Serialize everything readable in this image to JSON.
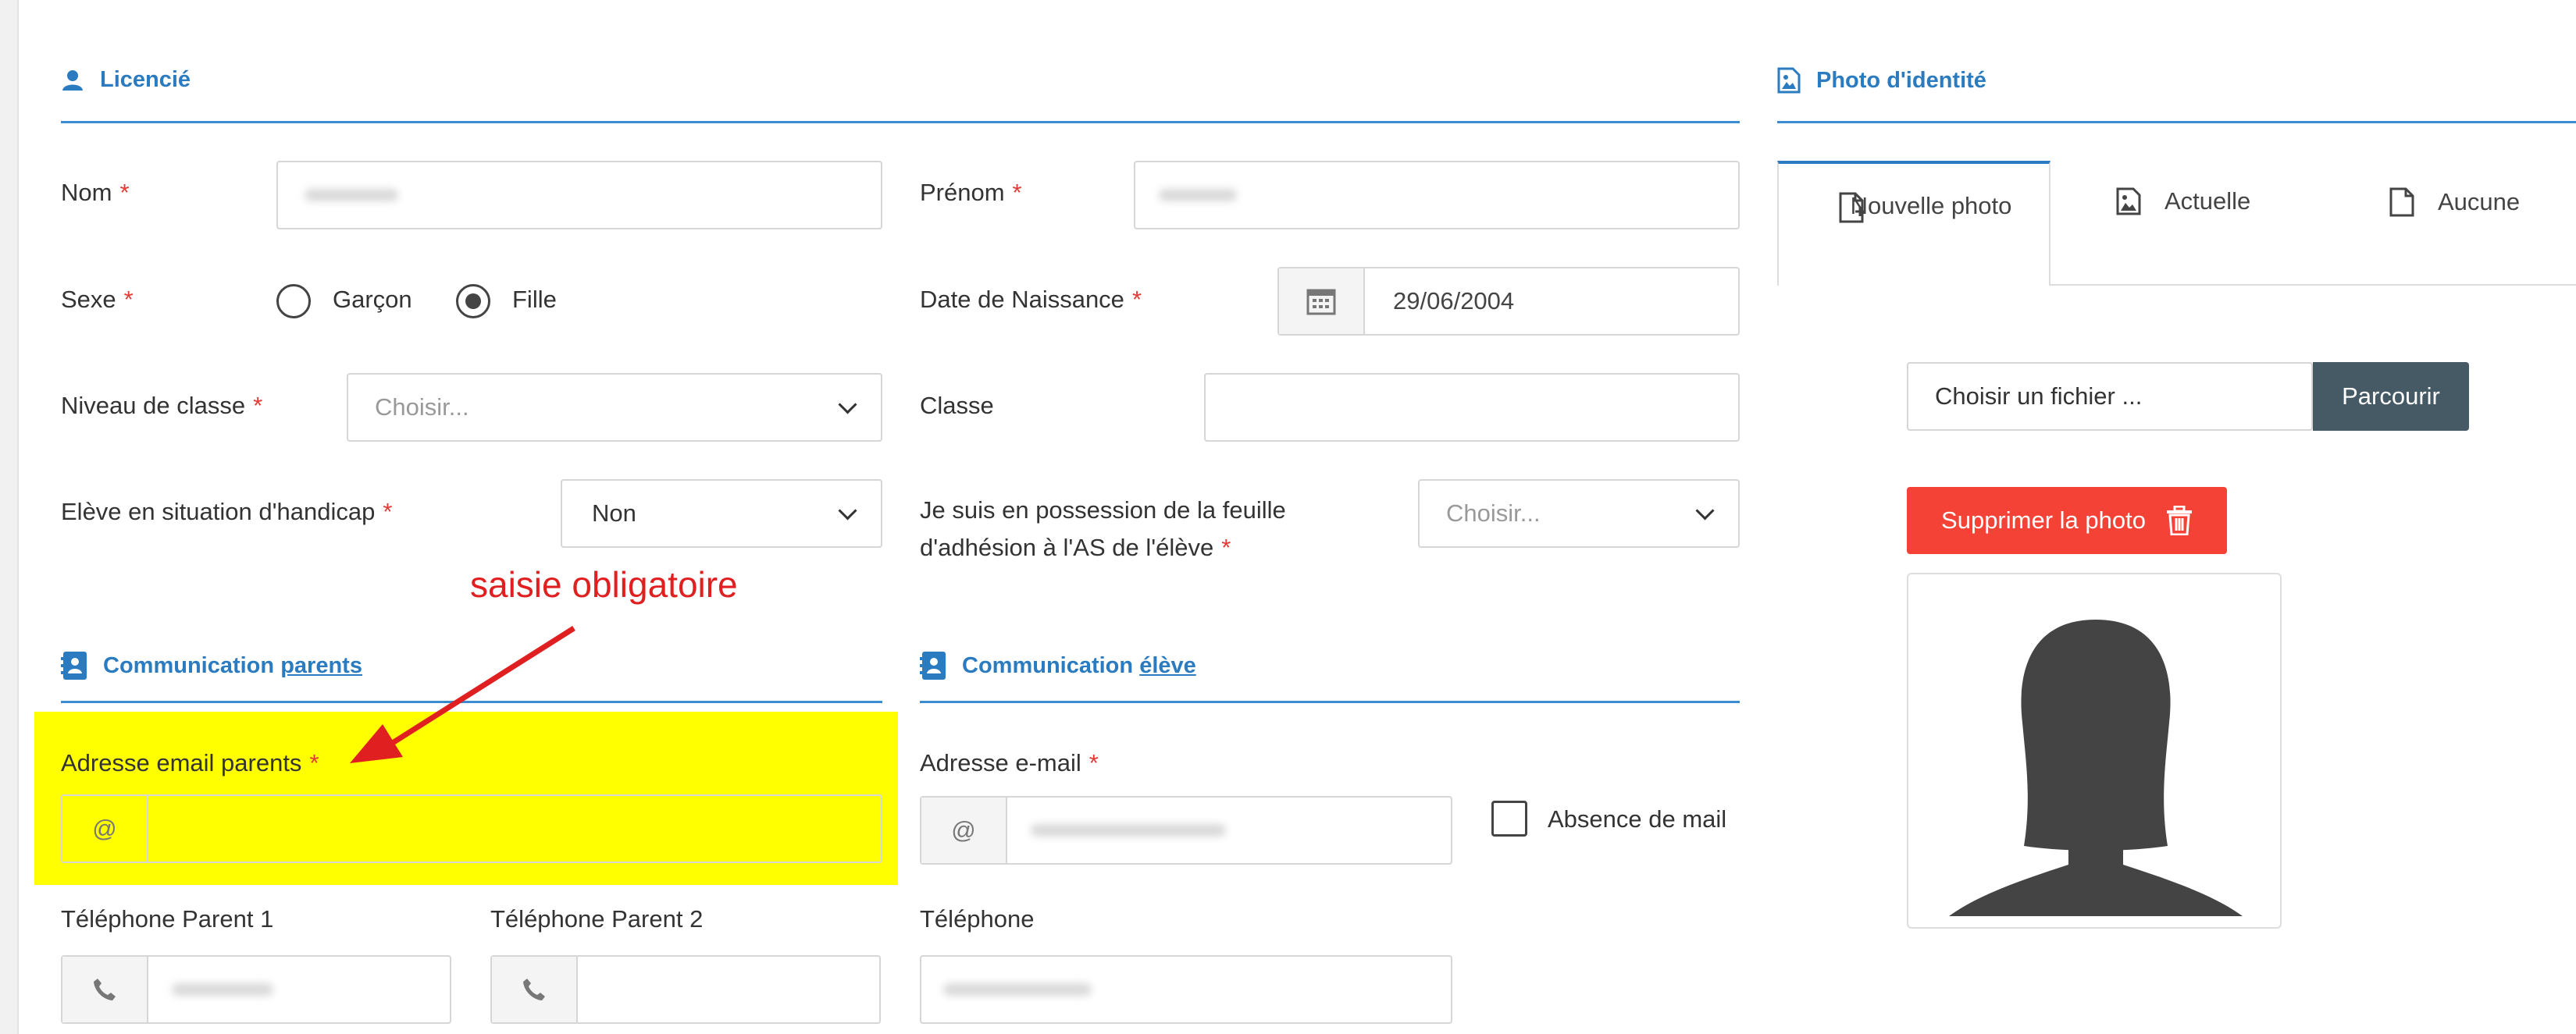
{
  "licencie": {
    "title": "Licencié",
    "icon": "user-icon",
    "nom": {
      "label": "Nom",
      "required": "*"
    },
    "prenom": {
      "label": "Prénom",
      "required": "*"
    },
    "sexe": {
      "label": "Sexe",
      "required": "*",
      "options": [
        "Garçon",
        "Fille"
      ],
      "selected": "Fille"
    },
    "date_naissance": {
      "label": "Date de Naissance",
      "required": "*",
      "value": "29/06/2004"
    },
    "niveau_classe": {
      "label": "Niveau de classe",
      "required": "*",
      "placeholder": "Choisir..."
    },
    "classe": {
      "label": "Classe",
      "value": ""
    },
    "handicap": {
      "label": "Elève en situation d'handicap",
      "required": "*",
      "value": "Non"
    },
    "feuille_as": {
      "label": "Je suis en possession de la feuille d'adhésion à l'AS de l'élève",
      "required": "*",
      "placeholder": "Choisir..."
    }
  },
  "annotation": {
    "text": "saisie obligatoire",
    "color": "#e02020",
    "highlight_color": "#ffff00"
  },
  "comm_parents": {
    "title": "Communication",
    "link": "parents",
    "icon": "address-book-icon",
    "email": {
      "label": "Adresse email parents",
      "required": "*",
      "addon": "@",
      "value": ""
    },
    "tel1": {
      "label": "Téléphone Parent 1",
      "addon_icon": "phone-icon"
    },
    "tel2": {
      "label": "Téléphone Parent 2",
      "addon_icon": "phone-icon",
      "value": ""
    }
  },
  "comm_eleve": {
    "title": "Communication",
    "link": "élève",
    "icon": "address-book-icon",
    "email": {
      "label": "Adresse e-mail",
      "required": "*",
      "addon": "@"
    },
    "absence_mail": "Absence de mail",
    "tel": {
      "label": "Téléphone"
    }
  },
  "photo": {
    "title": "Photo d'identité",
    "icon": "image-file-icon",
    "tabs": [
      {
        "label": "Nouvelle photo",
        "icon": "new-file-icon",
        "active": true
      },
      {
        "label": "Actuelle",
        "icon": "image-file-icon",
        "active": false
      },
      {
        "label": "Aucune",
        "icon": "blank-file-icon",
        "active": false
      }
    ],
    "file_placeholder": "Choisir un fichier ...",
    "browse_label": "Parcourir",
    "delete_label": "Supprimer la photo",
    "delete_icon": "trash-icon",
    "avatar": "female-silhouette-icon"
  },
  "colors": {
    "accent": "#2b7bc0",
    "required": "#e53935",
    "browse_bg": "#455a64",
    "delete_bg": "#f44336"
  }
}
